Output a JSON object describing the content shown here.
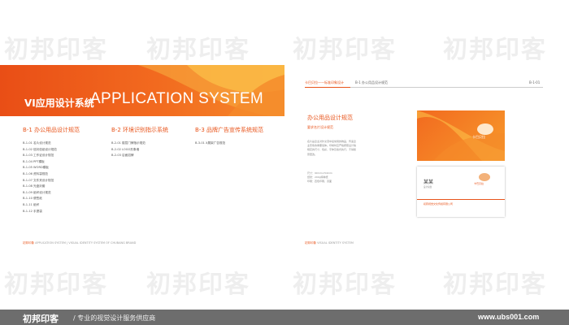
{
  "left_page": {
    "banner_cn": "VI应用设计系统",
    "banner_en": "APPLICATION SYSTEM",
    "sections": [
      {
        "heading": "B-1  办公用品设计规范",
        "items": [
          "B-1-01  名片设计规范",
          "B-1-02  信封信纸设计规范",
          "B-1-03  工作证设计规范",
          "B-1-04  PPT模板",
          "B-1-05  WORD模板",
          "B-1-06  资料袋规范",
          "B-1-07  文件夹设计规范",
          "B-1-08  光盘封套",
          "B-1-09  纸杯设计规范",
          "B-1-10  便签纸",
          "B-1-11  纸杯",
          "B-1-12  手提袋"
        ]
      },
      {
        "heading": "B-2  环境识别指示系统",
        "items": [
          "B-2-01  楼层门牌指示规范",
          "B-2-02  LOGO形象墙",
          "B-2-03  店面招牌"
        ]
      },
      {
        "heading": "B-3  品牌广告宣传系统规范",
        "items": [
          "B-3-01  X展架广告规范"
        ]
      }
    ],
    "footer_brand": "初邦印象",
    "footer_text": "APPLICATION SYSTEM  |  VISUAL IDENTITY SYSTEM OF CHUBANG BRAND"
  },
  "right_page": {
    "top_brand": "卡巴贝拉——标准印象设计",
    "top_section": "B-1  办公用品设计规范",
    "page_number": "B-1-01",
    "title": "办公用品设计规范",
    "subtitle": "要求名片设计规范",
    "body": "名片是企业对外交流中最常用的物品，传递企业形象的重要载体。印制时应严格按照设计稿规定的尺寸、色彩、字体及版式执行，不得随意更改。",
    "spec_lines": [
      "尺寸：90mm×54mm",
      "纸张：200g特种纸",
      "印刷：四色印刷，双面"
    ],
    "card_name": "某某",
    "card_title": "设计总监",
    "card_company": "初邦视觉文化传媒有限公司",
    "card_logo": "卡巴贝拉",
    "footer_brand": "初邦印象",
    "footer_text": "VISUAL IDENTITY SYSTEM"
  },
  "bottom_bar": {
    "logo": "初邦印客",
    "slogan": "/ 专业的视觉设计服务供应商",
    "url": "www.ubs001.com"
  },
  "watermark": "初邦印客"
}
